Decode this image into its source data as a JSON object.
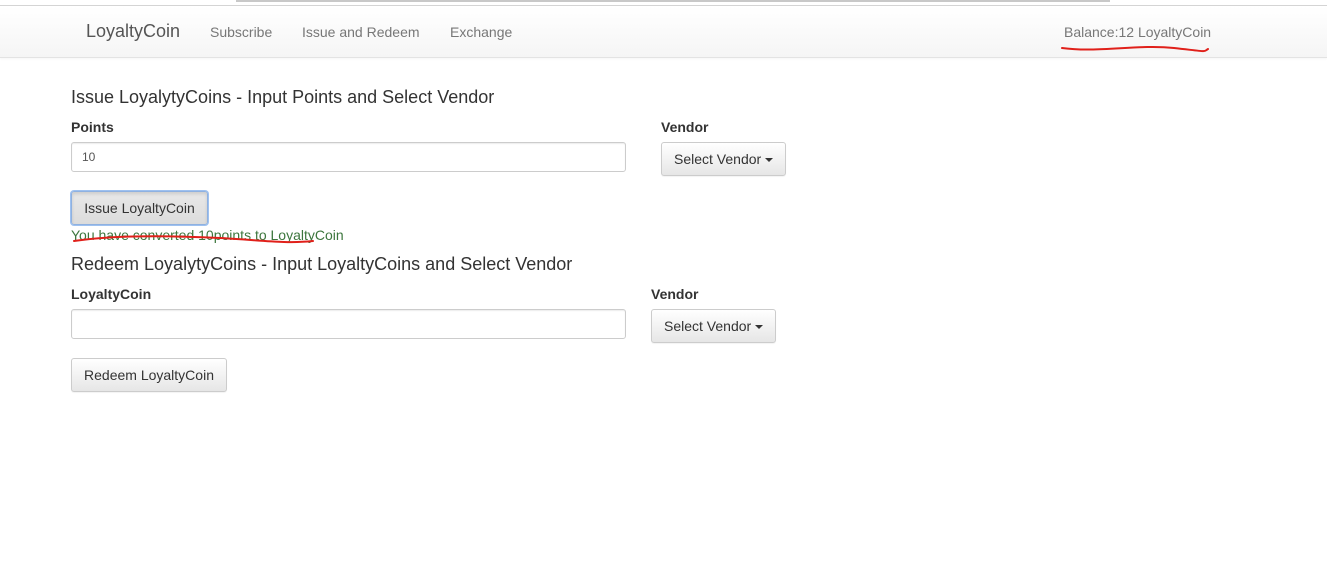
{
  "navbar": {
    "brand": "LoyaltyCoin",
    "links": [
      "Subscribe",
      "Issue and Redeem",
      "Exchange"
    ],
    "balance": "Balance:12 LoyaltyCoin"
  },
  "issue": {
    "title": "Issue LoyalytyCoins - Input Points and Select Vendor",
    "points_label": "Points",
    "points_value": "10",
    "vendor_label": "Vendor",
    "vendor_button": "Select Vendor",
    "submit_label": "Issue LoyaltyCoin",
    "message": "You have converted 10points to LoyaltyCoin"
  },
  "redeem": {
    "title": "Redeem LoyalytyCoins - Input LoyaltyCoins and Select Vendor",
    "coin_label": "LoyaltyCoin",
    "coin_value": "",
    "vendor_label": "Vendor",
    "vendor_button": "Select Vendor",
    "submit_label": "Redeem LoyaltyCoin"
  },
  "colors": {
    "success_text": "#3c763d",
    "annotation": "#e0201a"
  }
}
